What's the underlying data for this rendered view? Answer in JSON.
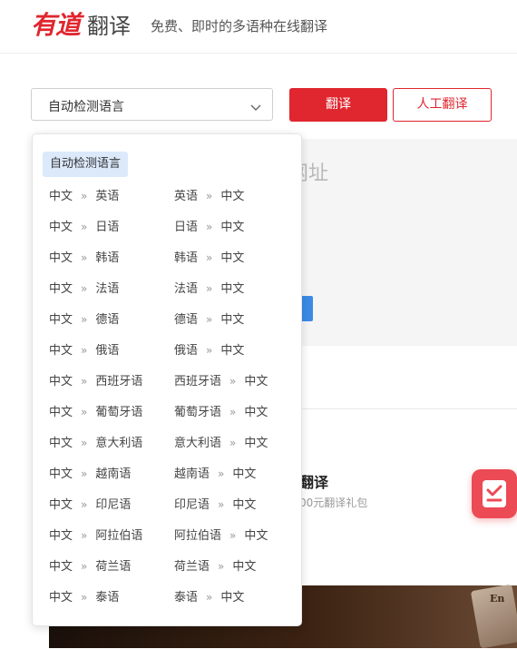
{
  "header": {
    "logo_red": "有道",
    "logo_gray": "翻译",
    "slogan": "免费、即时的多语种在线翻译"
  },
  "language_select": {
    "value": "自动检测语言"
  },
  "buttons": {
    "translate": "翻译",
    "human_translate": "人工翻译"
  },
  "input": {
    "placeholder_fragment": "网址"
  },
  "promo": {
    "title_fragment": "翻译",
    "subtitle_fragment": "00元翻译礼包"
  },
  "banner": {
    "card_text": "En"
  },
  "dropdown": {
    "auto_detect": "自动检测语言",
    "arrow": "»",
    "pairs": [
      {
        "left_from": "中文",
        "left_to": "英语",
        "right_from": "英语",
        "right_to": "中文"
      },
      {
        "left_from": "中文",
        "left_to": "日语",
        "right_from": "日语",
        "right_to": "中文"
      },
      {
        "left_from": "中文",
        "left_to": "韩语",
        "right_from": "韩语",
        "right_to": "中文"
      },
      {
        "left_from": "中文",
        "left_to": "法语",
        "right_from": "法语",
        "right_to": "中文"
      },
      {
        "left_from": "中文",
        "left_to": "德语",
        "right_from": "德语",
        "right_to": "中文"
      },
      {
        "left_from": "中文",
        "left_to": "俄语",
        "right_from": "俄语",
        "right_to": "中文"
      },
      {
        "left_from": "中文",
        "left_to": "西班牙语",
        "right_from": "西班牙语",
        "right_to": "中文"
      },
      {
        "left_from": "中文",
        "left_to": "葡萄牙语",
        "right_from": "葡萄牙语",
        "right_to": "中文"
      },
      {
        "left_from": "中文",
        "left_to": "意大利语",
        "right_from": "意大利语",
        "right_to": "中文"
      },
      {
        "left_from": "中文",
        "left_to": "越南语",
        "right_from": "越南语",
        "right_to": "中文"
      },
      {
        "left_from": "中文",
        "left_to": "印尼语",
        "right_from": "印尼语",
        "right_to": "中文"
      },
      {
        "left_from": "中文",
        "left_to": "阿拉伯语",
        "right_from": "阿拉伯语",
        "right_to": "中文"
      },
      {
        "left_from": "中文",
        "left_to": "荷兰语",
        "right_from": "荷兰语",
        "right_to": "中文"
      },
      {
        "left_from": "中文",
        "left_to": "泰语",
        "right_from": "泰语",
        "right_to": "中文"
      }
    ]
  },
  "colors": {
    "brand_red": "#e0262f",
    "selected_bg": "#dbe9fb",
    "accent_blue": "#3b8be6"
  }
}
